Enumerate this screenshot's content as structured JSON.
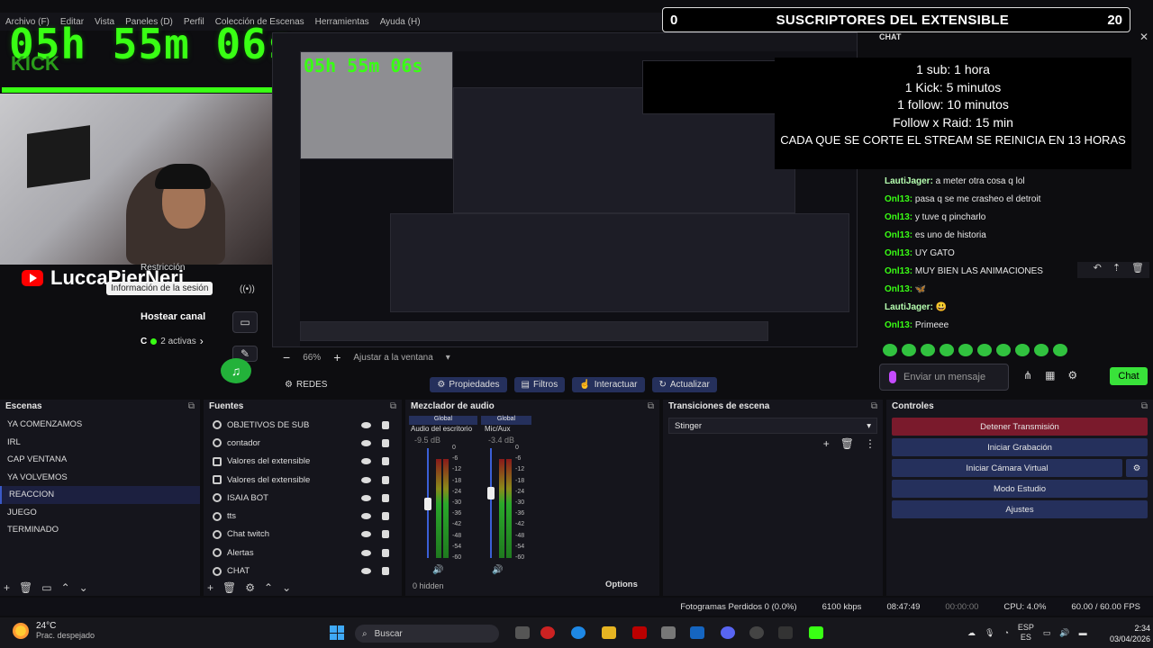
{
  "menubar": [
    "Archivo (F)",
    "Editar",
    "Vista",
    "Paneles (D)",
    "Perfil",
    "Colección de Escenas",
    "Herramientas",
    "Ayuda (H)"
  ],
  "overlay": {
    "timer": "05h 55m 06s",
    "platform": "KICK",
    "channel_name": "LuccaPierNeri",
    "tooltip": "Información de la sesión",
    "restriction": "Restricción",
    "host_channel": "Hostear canal",
    "active_count": "2 activas",
    "sub_banner": {
      "left_count": "0",
      "title": "SUSCRIPTORES DEL EXTENSIBLE",
      "right_count": "20"
    },
    "rules": [
      "1 sub: 1 hora",
      "1 Kick: 5 minutos",
      "1 follow: 10 minutos",
      "Follow x Raid: 15 min",
      "CADA QUE SE CORTE EL STREAM SE REINICIA EN 13 HORAS"
    ]
  },
  "preview": {
    "zoom": "66%",
    "fit_label": "Ajustar a la ventana"
  },
  "chat": {
    "title": "CHAT",
    "messages": [
      {
        "user": "LautiJager:",
        "text": " a meter otra cosa q lol"
      },
      {
        "user": "Onl13:",
        "text": " pasa q se me crasheo el detroit"
      },
      {
        "user": "Onl13:",
        "text": " y tuve q pincharlo"
      },
      {
        "user": "Onl13:",
        "text": " es uno de historia"
      },
      {
        "user": "Onl13:",
        "text": " UY GATO"
      },
      {
        "user": "Onl13:",
        "text": " MUY BIEN LAS ANIMACIONES"
      },
      {
        "user": "Onl13:",
        "text": " 🦋"
      },
      {
        "user": "LautiJager:",
        "text": " 😃"
      },
      {
        "user": "Onl13:",
        "text": " Primeee"
      }
    ],
    "input_placeholder": "Enviar un mensaje",
    "send_label": "Chat"
  },
  "dock_tabs": {
    "scene": "REDES",
    "properties": "Propiedades",
    "filters": "Filtros",
    "interact": "Interactuar",
    "refresh": "Actualizar"
  },
  "scenes": {
    "title": "Escenas",
    "items": [
      "YA COMENZAMOS",
      "IRL",
      "CAP VENTANA",
      "YA VOLVEMOS",
      "REACCION",
      "JUEGO",
      "TERMINADO"
    ],
    "selected": "REACCION"
  },
  "sources": {
    "title": "Fuentes",
    "items": [
      "OBJETIVOS DE SUB",
      "contador",
      "Valores del extensible",
      "Valores del extensible",
      "ISAIA BOT",
      "tts",
      "Chat twitch",
      "Alertas",
      "CHAT"
    ]
  },
  "mixer": {
    "title": "Mezclador de audio",
    "channels": [
      {
        "badge": "Global",
        "name": "Audio del escritorio",
        "db": "-9.5 dB",
        "level": 0.55
      },
      {
        "badge": "Global",
        "name": "Mic/Aux",
        "db": "-3.4 dB",
        "level": 0.65
      }
    ],
    "scale": [
      "0",
      "-6",
      "-12",
      "-18",
      "-24",
      "-30",
      "-36",
      "-42",
      "-48",
      "-54",
      "-60"
    ],
    "hidden": "0 hidden",
    "options": "Options"
  },
  "transitions": {
    "title": "Transiciones de escena",
    "selected": "Stinger"
  },
  "controls": {
    "title": "Controles",
    "buttons": [
      "Detener Transmisión",
      "Iniciar Grabación",
      "Iniciar Cámara Virtual",
      "Modo Estudio",
      "Ajustes"
    ]
  },
  "status": {
    "dropped": "Fotogramas Perdidos 0 (0.0%)",
    "bitrate": "6100 kbps",
    "stream_time": "08:47:49",
    "rec_time": "00:00:00",
    "cpu": "CPU: 4.0%",
    "fps": "60.00 / 60.00 FPS"
  },
  "taskbar": {
    "temp": "24°C",
    "weather": "Prac. despejado",
    "search": "Buscar",
    "lang1": "ESP",
    "lang2": "ES",
    "time": "2:34",
    "date": "03/04/2026"
  },
  "colors": {
    "accent": "#39ff14",
    "obs_button": "#25305c",
    "stop_button": "#7a1a2c"
  }
}
